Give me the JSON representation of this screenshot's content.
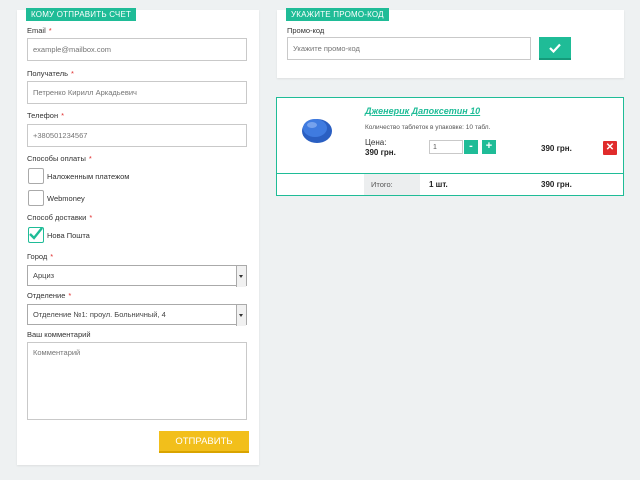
{
  "order_form": {
    "tag": "Кому отправить счет",
    "email": {
      "label": "Email",
      "placeholder": "example@mailbox.com"
    },
    "recipient": {
      "label": "Получатель",
      "placeholder": "Петренко Кирилл Аркадьевич"
    },
    "phone": {
      "label": "Телефон",
      "placeholder": "+380501234567"
    },
    "payment": {
      "label": "Способы оплаты",
      "options": [
        {
          "label": "Наложенным платежом",
          "checked": false
        },
        {
          "label": "Webmoney",
          "checked": false
        }
      ]
    },
    "delivery": {
      "label": "Способ доставки",
      "options": [
        {
          "label": "Нова Пошта",
          "checked": true
        }
      ]
    },
    "city": {
      "label": "Город",
      "value": "Арциз"
    },
    "branch": {
      "label": "Отделение",
      "value": "Отделение №1: проул. Больничный, 4"
    },
    "comment": {
      "label": "Ваш комментарий",
      "placeholder": "Комментарий"
    },
    "required_mark": "*",
    "submit_label": "Отправить"
  },
  "promo": {
    "tag": "Укажите промо-код",
    "label": "Промо-код",
    "placeholder": "Укажите промо-код",
    "apply_icon": "check-icon"
  },
  "cart": {
    "item": {
      "name": "Дженерик Дапоксетин 10",
      "pack_info": "Количество таблеток в упаковке: 10 табл.",
      "price_label": "Цена:",
      "price": "390 грн.",
      "quantity": "1",
      "minus": "-",
      "plus": "+",
      "line_total": "390 грн."
    },
    "summary": {
      "label": "Итого:",
      "count": "1 шт.",
      "total": "390 грн."
    }
  },
  "colors": {
    "accent": "#1fbc97",
    "submit": "#f2bf1b",
    "delete": "#e02b2b"
  }
}
